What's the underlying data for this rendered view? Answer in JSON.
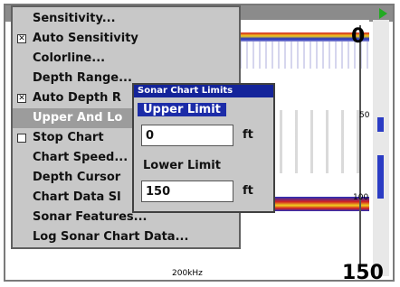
{
  "menu": {
    "items": [
      {
        "label": "Sensitivity...",
        "checked": false,
        "has_checkbox": false
      },
      {
        "label": "Auto Sensitivity",
        "checked": true,
        "has_checkbox": true
      },
      {
        "label": "Colorline...",
        "checked": false,
        "has_checkbox": false
      },
      {
        "label": "Depth Range...",
        "checked": false,
        "has_checkbox": false
      },
      {
        "label": "Auto Depth R",
        "checked": true,
        "has_checkbox": true
      },
      {
        "label": "Upper And Lo",
        "checked": false,
        "has_checkbox": false,
        "selected": true
      },
      {
        "label": "Stop Chart",
        "checked": false,
        "has_checkbox": true
      },
      {
        "label": "Chart Speed...",
        "checked": false,
        "has_checkbox": false
      },
      {
        "label": "Depth Cursor",
        "checked": false,
        "has_checkbox": false
      },
      {
        "label": "Chart Data Sl",
        "checked": false,
        "has_checkbox": false
      },
      {
        "label": "Sonar Features...",
        "checked": false,
        "has_checkbox": false
      },
      {
        "label": "Log Sonar Chart Data...",
        "checked": false,
        "has_checkbox": false
      }
    ]
  },
  "dialog": {
    "title": "Sonar Chart Limits",
    "upper_label": "Upper Limit",
    "upper_value": "0",
    "upper_unit": "ft",
    "lower_label": "Lower Limit",
    "lower_value": "150",
    "lower_unit": "ft"
  },
  "chart": {
    "scale_top": "0",
    "scale_mid": "50",
    "scale_low": "100",
    "scale_bottom": "150",
    "frequency": "200kHz"
  },
  "colors": {
    "menu_bg": "#c8c8c8",
    "selected_bg": "#9c9c9c",
    "dialog_title_bg": "#14249a",
    "sonar_red": "#d42020",
    "sonar_yellow": "#f0d020",
    "sonar_blue": "#2030c0"
  }
}
